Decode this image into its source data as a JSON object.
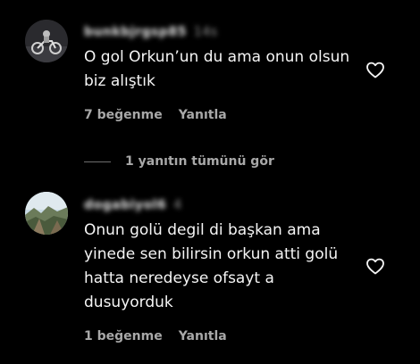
{
  "comments": [
    {
      "username": "bunkbjrgsp85",
      "time": "14s",
      "text": "O gol Orkun’un du ama onun olsun biz alıştık",
      "likes": "7 beğenme",
      "reply_label": "Yanıtla",
      "avatar_icon": "motorcycle-photo"
    },
    {
      "username": "dogabiyol6",
      "time": "4",
      "text": "Onun golü degil di başkan ama yinede sen bilirsin orkun atti golü hatta neredeyse ofsayt a dusuyorduk",
      "likes": "1 beğenme",
      "reply_label": "Yanıtla",
      "avatar_icon": "landscape-photo"
    }
  ],
  "view_replies": {
    "label": "1 yanıtın tümünü gör"
  },
  "colors": {
    "background": "#000000",
    "text": "#f5f5f5",
    "secondary": "#a8a8a8"
  }
}
